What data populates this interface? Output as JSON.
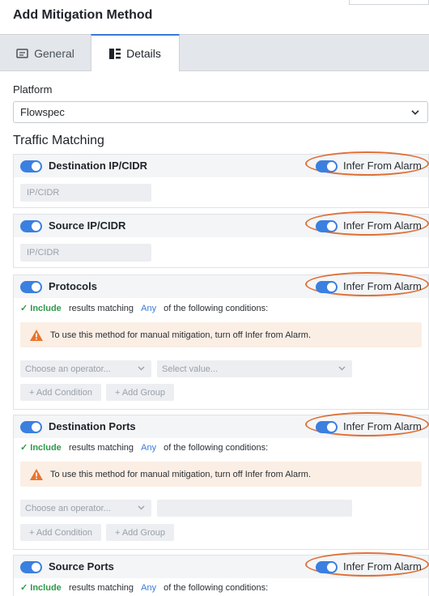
{
  "dialog": {
    "title": "Add Mitigation Method"
  },
  "tabs": [
    {
      "label": "General",
      "icon": "card-icon"
    },
    {
      "label": "Details",
      "icon": "list-icon"
    }
  ],
  "platform": {
    "label": "Platform",
    "value": "Flowspec"
  },
  "traffic_matching": {
    "heading": "Traffic Matching",
    "infer_label": "Infer From Alarm",
    "ip_placeholder": "IP/CIDR",
    "include": "✓ Include",
    "results_matching": "results matching",
    "any": "Any",
    "of_following": "of the following conditions:",
    "warning": "To use this method for manual mitigation, turn off Infer from Alarm.",
    "operator_placeholder": "Choose an operator...",
    "value_placeholder": "Select value...",
    "add_condition": "+ Add Condition",
    "add_group": "+ Add Group",
    "sections": [
      {
        "title": "Destination IP/CIDR",
        "enabled": true,
        "infer": true
      },
      {
        "title": "Source IP/CIDR",
        "enabled": true,
        "infer": true
      },
      {
        "title": "Protocols",
        "enabled": true,
        "infer": true
      },
      {
        "title": "Destination Ports",
        "enabled": true,
        "infer": true
      },
      {
        "title": "Source Ports",
        "enabled": true,
        "infer": true
      }
    ]
  },
  "colors": {
    "accent": "#3b7fe0",
    "highlight": "#e07035",
    "include": "#2e9a4a",
    "warning_bg": "#fbeee4"
  }
}
